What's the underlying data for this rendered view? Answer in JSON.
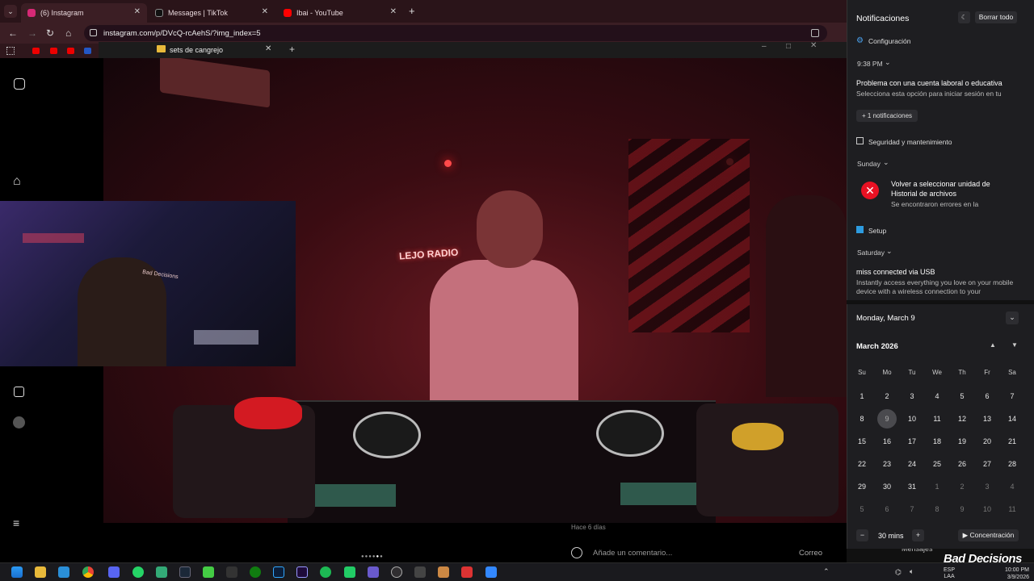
{
  "browser": {
    "tabs": [
      {
        "label": "(6) Instagram"
      },
      {
        "label": "Messages | TikTok"
      },
      {
        "label": "Ibai - YouTube"
      }
    ],
    "url": "instagram.com/p/DVcQ-rcAehS/?img_index=5"
  },
  "explorer": {
    "tab_label": "sets de cangrejo"
  },
  "video": {
    "sign_text": "LEJO RADIO",
    "cap_text": "Bad Decisions"
  },
  "instagram": {
    "time_ago": "Hace 6 días",
    "comment_placeholder": "Añade un comentario...",
    "post_label": "Correo",
    "messages_label": "Mensajes"
  },
  "watermark": "Bad Decisions",
  "notifications": {
    "title": "Notificaciones",
    "clear_all": "Borrar todo",
    "settings": "Configuración",
    "groups": [
      {
        "time": "9:38 PM",
        "title": "Problema con una cuenta laboral o educativa",
        "body": "Selecciona esta opción para iniciar sesión en tu",
        "more": "+ 1 notificaciones"
      },
      {
        "app": "Seguridad y mantenimiento"
      },
      {
        "time": "Sunday",
        "title": "Volver a seleccionar unidad de Historial de archivos",
        "body": "Se encontraron errores en la"
      },
      {
        "app": "Setup"
      },
      {
        "time": "Saturday",
        "title": "miss connected via USB",
        "body": "Instantly access everything you love on your mobile device with a wireless connection to your"
      }
    ]
  },
  "calendar": {
    "date_header": "Monday, March 9",
    "month": "March 2026",
    "weekdays": [
      "Su",
      "Mo",
      "Tu",
      "We",
      "Th",
      "Fr",
      "Sa"
    ],
    "weeks": [
      [
        "1",
        "2",
        "3",
        "4",
        "5",
        "6",
        "7"
      ],
      [
        "8",
        "9",
        "10",
        "11",
        "12",
        "13",
        "14"
      ],
      [
        "15",
        "16",
        "17",
        "18",
        "19",
        "20",
        "21"
      ],
      [
        "22",
        "23",
        "24",
        "25",
        "26",
        "27",
        "28"
      ],
      [
        "29",
        "30",
        "31",
        "1",
        "2",
        "3",
        "4"
      ],
      [
        "5",
        "6",
        "7",
        "8",
        "9",
        "10",
        "11"
      ]
    ],
    "today": "9",
    "focus_minutes": "30 mins",
    "focus_label": "Concentración"
  },
  "taskbar": {
    "lang": "ESP",
    "lang2": "LAA",
    "time": "10:00 PM",
    "date": "3/9/2026"
  },
  "colors": {
    "accent": "#e81123",
    "tiktok": "#ffffff",
    "youtube": "#ff0000",
    "instagram": "#d62976"
  }
}
